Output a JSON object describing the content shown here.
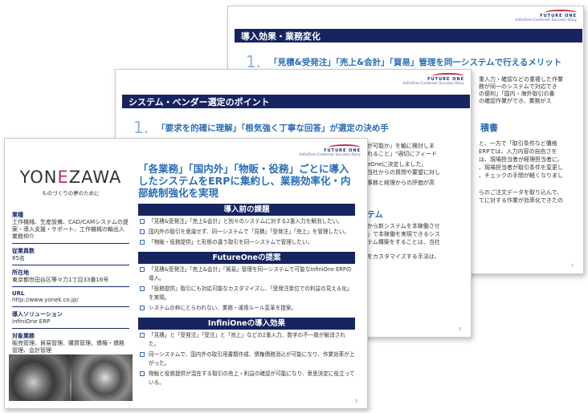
{
  "back_page": {
    "logo": {
      "brand": "FUTURE ONE",
      "tagline": "InfiniOne Customer Success Story"
    },
    "bar_title": "導入効果・業務変化",
    "headline_num": "1.",
    "headline": "「見積&受発注」「売上&会計」「貿易」管理を同一システムで行えるメリット",
    "subhead": "積書",
    "fragments": [
      "重入力・確認などの重複した作業",
      "務が同一のシステムで対応でき",
      "の便利」「国内・海外取引の書",
      "の確認作業ができ、業務がス",
      "と、一方で「取引条件など價格",
      "ERPでは、入力内容の自由さを",
      "は、現場担当者が経理担当者に、",
      "、現場担当者が取引条件を変更し",
      "、チェックの手間が軽くなりまし",
      "らのご注文データを取り込んで、",
      "てに対する作業が効率化できたの"
    ],
    "page_number": "7"
  },
  "middle_page": {
    "logo": {
      "brand": "FUTURE ONE",
      "tagline": "InfiniOne Customer Success Story"
    },
    "bar_title": "システム・ベンダー選定のポイント",
    "headline_num": "1.",
    "headline": "「要求を的確に理解」「根気強く丁寧な回答」が選定の決め手",
    "fragments": [
      "が可能か」を軸に検討しま",
      "れること」\"適切にフィード",
      "eOneに決定しました。",
      "当社からの質問や要望に対し",
      "事務と経理からの評価が高"
    ],
    "subhead": "テム",
    "fragments2": [
      "から新システムを本稼働させ",
      "」で本稼働を実現できるシス",
      "テム構築をすることは、当社",
      "をカスタマイズする手法は、"
    ],
    "page_number": "5"
  },
  "front_page": {
    "logo": {
      "brand": "FUTURE ONE",
      "tagline": "InfiniOne Customer Success Story"
    },
    "company": {
      "name_pre": "YON",
      "name_mark": "E",
      "name_post": "ZAWA",
      "slogan": "ものづくりの夢のために"
    },
    "info": [
      {
        "label": "業種",
        "value": "工作機械、生産設備、CAD/CAMシステムの提案・導入支援・サポート、工作機械の輸出入業務仲介"
      },
      {
        "label": "従業員数",
        "value": "85名"
      },
      {
        "label": "所在地",
        "value": "東京都世田谷区等々力1丁目33番16号"
      },
      {
        "label": "URL",
        "value": "http://www.yonek.co.jp/"
      },
      {
        "label": "導入ソリューション",
        "value": "InfiniOne ERP"
      },
      {
        "label": "対象業務",
        "value": "販売管理、貿易管理、購買管理、債権・債務管理、会計管理"
      }
    ],
    "title": "「各業務」「国内外」「物販・役務」ごとに導入したシステムをERPに集約し、業務効率化・内部統制強化を実現",
    "sections": [
      {
        "heading": "導入前の課題",
        "bullets": [
          "「見積&受発注」「売上&会計」と別々のシステムに対する2重入力を解消したい。",
          "国内外の取引を意識せず、同一システムで「見積」「受発注」「売上」を管理したい。",
          "「物販・役務提供」と形態の違う取引を同一システムで管理したい。"
        ]
      },
      {
        "heading": "FutureOneの提案",
        "bullets": [
          "「見積&受発注」「売上&会計」「貿易」管理を同一システムで可能なInfiniOne ERPの導入。",
          "「役務提供」取引にも対応可能なカスタマイズし、「受発注単位での利益の見える化」を実現。",
          "システムの枠にとらわれない、業務・運用ルール変革を提案。"
        ]
      },
      {
        "heading": "InfiniOneの導入効果",
        "bullets": [
          "「見積」と「受発注」「受注」と「売上」などの2重入力、数字の不一致が解消された。",
          "同一システムで、国内外の取引用書類作成、債権債務消込が可能になり、作業効率が上がった。",
          "物販と役務提供が混在する取引の売上・利益の確認が可能になり、意思決定に役立っている。"
        ]
      }
    ],
    "page_number": "3"
  }
}
